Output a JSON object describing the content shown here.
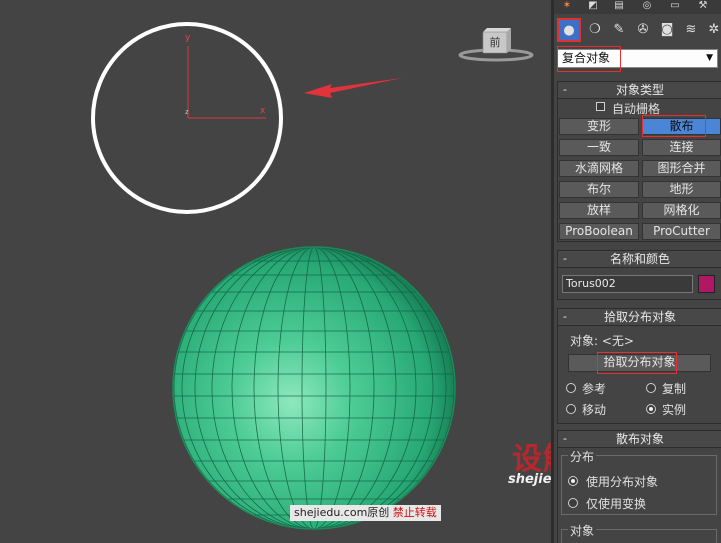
{
  "viewport": {
    "navcube_label": "前",
    "axis_x": "x",
    "axis_y": "y",
    "axis_z": "z",
    "watermark_site": "shejiedu.com",
    "watermark_original": "原创",
    "watermark_forbid": "禁止转载",
    "logo_cn": "设解读",
    "logo_url": "shejiedu.com"
  },
  "panel": {
    "tab_icons": [
      "create-icon",
      "modify-icon",
      "hierarchy-icon",
      "motion-icon",
      "display-icon",
      "utilities-icon"
    ],
    "category_icons": [
      "geometry-icon",
      "shapes-icon",
      "lights-icon",
      "cameras-icon",
      "helpers-icon",
      "spacewarps-icon",
      "systems-icon"
    ],
    "dropdown_value": "复合对象",
    "object_type": {
      "title": "对象类型",
      "autogrid_label": "自动栅格",
      "buttons": [
        "变形",
        "散布",
        "一致",
        "连接",
        "水滴网格",
        "图形合并",
        "布尔",
        "地形",
        "放样",
        "网格化",
        "ProBoolean",
        "ProCutter"
      ],
      "selected": "散布"
    },
    "name_color": {
      "title": "名称和颜色",
      "name_value": "Torus002",
      "color": "#b11765"
    },
    "pick_distribution": {
      "title": "拾取分布对象",
      "object_label": "对象: <无>",
      "pick_button": "拾取分布对象",
      "options": [
        {
          "label": "参考",
          "checked": false
        },
        {
          "label": "复制",
          "checked": false
        },
        {
          "label": "移动",
          "checked": false
        },
        {
          "label": "实例",
          "checked": true
        }
      ]
    },
    "scatter_objects": {
      "title": "散布对象",
      "group_label": "分布",
      "options": [
        {
          "label": "使用分布对象",
          "checked": true
        },
        {
          "label": "仅使用变换",
          "checked": false
        }
      ],
      "objects_group_label": "对象"
    }
  },
  "colors": {
    "viewport_bg": "#444444",
    "sphere_fill": "#2dbb82",
    "sphere_wire": "#0f5e3e",
    "circle_stroke": "#ffffff",
    "arrow": "#e2323a",
    "selected_button": "#4b86d6",
    "highlight_box": "#e43030"
  }
}
